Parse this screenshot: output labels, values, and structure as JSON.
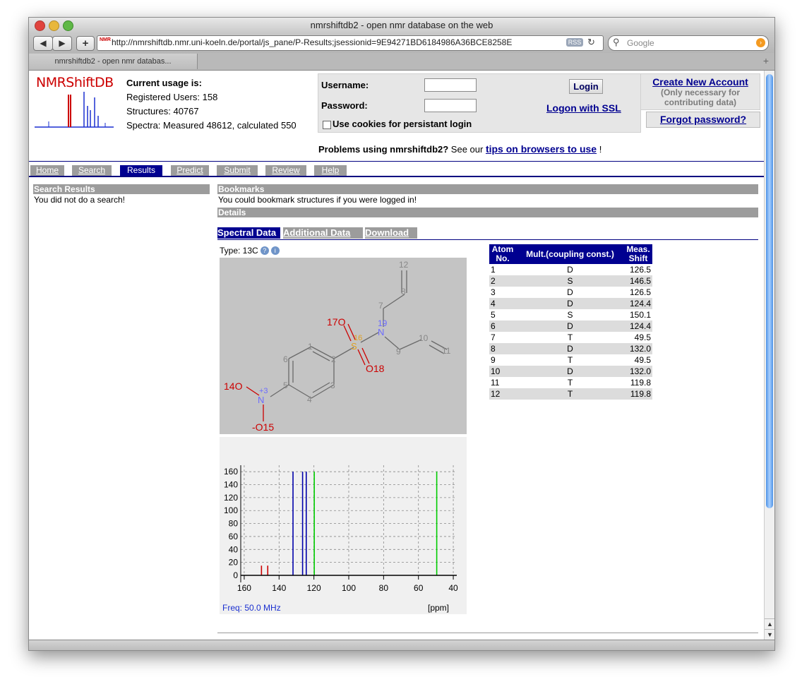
{
  "window": {
    "title": "nmrshiftdb2 - open nmr database on the web"
  },
  "toolbar": {
    "back": "◀",
    "forward": "▶",
    "add": "+",
    "favicon": "NMR",
    "url": "http://nmrshiftdb.nmr.uni-koeln.de/portal/js_pane/P-Results;jsessionid=9E94271BD6184986A36BCE8258E",
    "rss": "RSS",
    "search_placeholder": "Google"
  },
  "tabs": [
    {
      "label": "nmrshiftdb2 - open nmr databas..."
    }
  ],
  "logo": {
    "text": "NMRShiftDB"
  },
  "usage": {
    "heading": "Current usage is:",
    "users": "Registered Users: 158",
    "structures": "Structures: 40767",
    "spectra": "Spectra: Measured 48612, calculated 550"
  },
  "login": {
    "username_label": "Username:",
    "password_label": "Password:",
    "login_button": "Login",
    "ssl_link": "Logon with SSL",
    "cookies_label": "Use cookies for persistant login"
  },
  "account": {
    "create_link": "Create New Account",
    "create_note": "(Only necessary for contributing data)",
    "forgot_link": "Forgot password?"
  },
  "problems": {
    "lead": "Problems using nmrshiftdb2?",
    "middle": " See our ",
    "link": "tips on browsers to use",
    "tail": " !"
  },
  "nav": [
    "Home",
    "Search",
    "Results",
    "Predict",
    "Submit",
    "Review",
    "Help"
  ],
  "nav_active": "Results",
  "left": {
    "heading": "Search Results",
    "text": "You did not do a search!"
  },
  "bookmarks": {
    "heading": "Bookmarks",
    "text": "You could bookmark structures if you were logged in!"
  },
  "details": {
    "heading": "Details"
  },
  "subtabs": [
    "Spectral Data",
    "Additional Data",
    "Download"
  ],
  "spectrum_type": "Type: 13C",
  "molecule": {
    "atom_labels": [
      "1",
      "2",
      "3",
      "4",
      "5",
      "6",
      "7",
      "8",
      "9",
      "10",
      "11",
      "12"
    ],
    "nitrogen_label": "N",
    "nitro_charge": "+3",
    "nitrogen_index": "19",
    "sulfur_label": "S",
    "sulfur_index": "16",
    "o14": "14O",
    "o15": "-O15",
    "o17": "17O",
    "o18": "O18"
  },
  "table": {
    "headers": [
      "Atom No.",
      "Mult.(coupling const.)",
      "Meas. Shift"
    ],
    "rows": [
      {
        "atom": "1",
        "mult": "D",
        "shift": "126.5"
      },
      {
        "atom": "2",
        "mult": "S",
        "shift": "146.5"
      },
      {
        "atom": "3",
        "mult": "D",
        "shift": "126.5"
      },
      {
        "atom": "4",
        "mult": "D",
        "shift": "124.4"
      },
      {
        "atom": "5",
        "mult": "S",
        "shift": "150.1"
      },
      {
        "atom": "6",
        "mult": "D",
        "shift": "124.4"
      },
      {
        "atom": "7",
        "mult": "T",
        "shift": "49.5"
      },
      {
        "atom": "8",
        "mult": "D",
        "shift": "132.0"
      },
      {
        "atom": "9",
        "mult": "T",
        "shift": "49.5"
      },
      {
        "atom": "10",
        "mult": "D",
        "shift": "132.0"
      },
      {
        "atom": "11",
        "mult": "T",
        "shift": "119.8"
      },
      {
        "atom": "12",
        "mult": "T",
        "shift": "119.8"
      }
    ]
  },
  "chart_data": {
    "type": "bar",
    "xlabel": "[ppm]",
    "ylabel": "",
    "x_reversed": true,
    "xlim": [
      162,
      38
    ],
    "ylim": [
      0,
      170
    ],
    "xticks": [
      160,
      140,
      120,
      100,
      80,
      60,
      40
    ],
    "yticks": [
      0,
      20,
      40,
      60,
      80,
      100,
      120,
      140,
      160
    ],
    "grid": true,
    "annotation": "Freq: 50.0 MHz",
    "peaks": [
      {
        "shift": 150.1,
        "intensity": 15,
        "color": "#cc0000"
      },
      {
        "shift": 146.5,
        "intensity": 15,
        "color": "#cc0000"
      },
      {
        "shift": 132.0,
        "intensity": 160,
        "color": "#0000aa"
      },
      {
        "shift": 126.5,
        "intensity": 160,
        "color": "#0000aa"
      },
      {
        "shift": 124.4,
        "intensity": 160,
        "color": "#0000aa"
      },
      {
        "shift": 119.8,
        "intensity": 160,
        "color": "#00cc00"
      },
      {
        "shift": 49.5,
        "intensity": 160,
        "color": "#00cc00"
      }
    ]
  }
}
